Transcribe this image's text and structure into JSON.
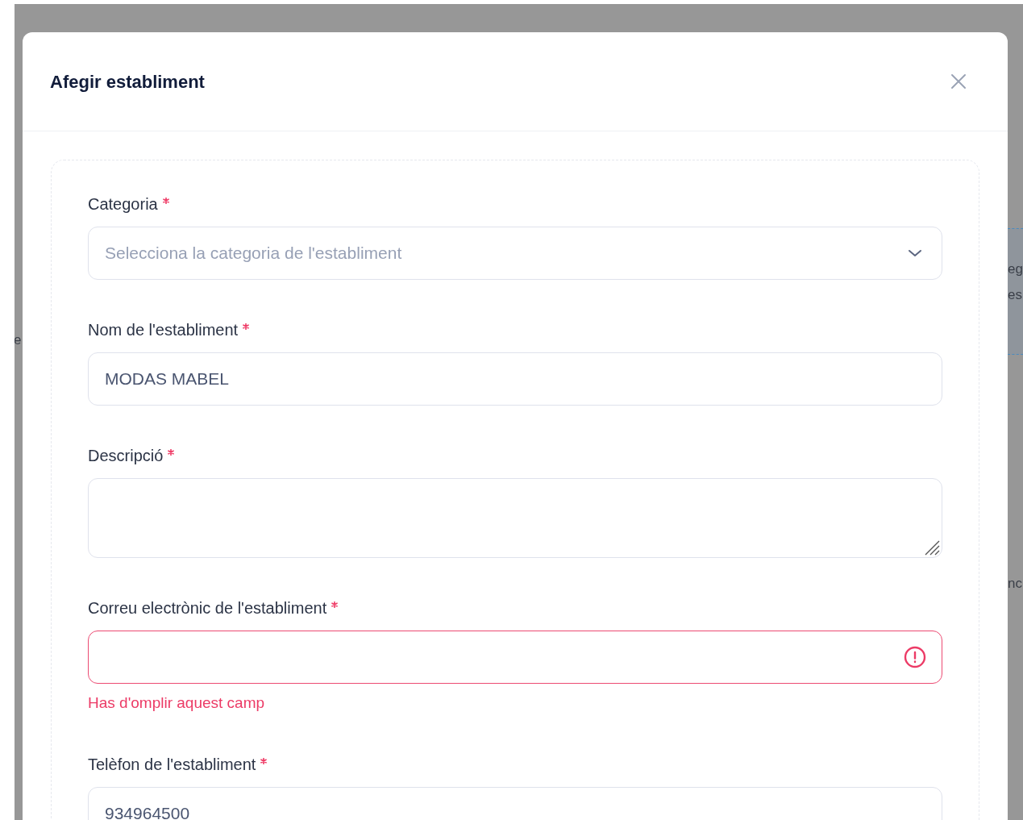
{
  "background_fragments": [
    "e",
    "eg",
    "es",
    "nc"
  ],
  "modal": {
    "title": "Afegir establiment"
  },
  "fields": [
    {
      "kind": "select",
      "label": "Categoria",
      "required": true,
      "placeholder": "Selecciona la categoria de l'establiment",
      "invalid": false
    },
    {
      "kind": "text",
      "label": "Nom de l'establiment",
      "required": true,
      "value": "MODAS MABEL",
      "invalid": false
    },
    {
      "kind": "textarea",
      "label": "Descripció",
      "required": true,
      "invalid": false
    },
    {
      "kind": "text",
      "label": "Correu electrònic de l'establiment",
      "required": true,
      "invalid": true,
      "error": "Has d'omplir aquest camp"
    },
    {
      "kind": "text",
      "label": "Telèfon de l'establiment",
      "required": true,
      "value": "934964500",
      "invalid": false
    }
  ]
}
